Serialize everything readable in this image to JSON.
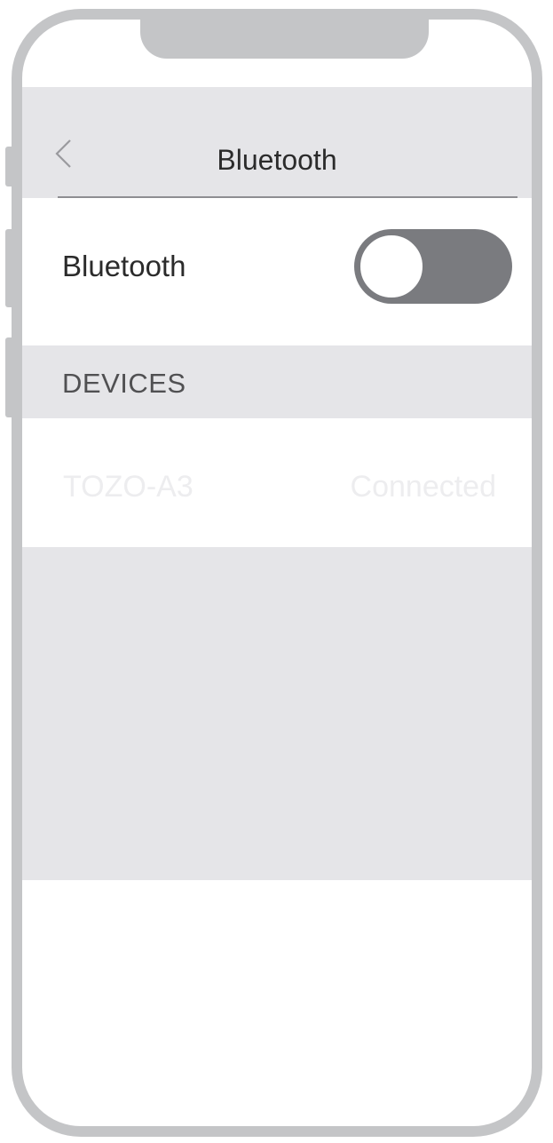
{
  "nav": {
    "title": "Bluetooth",
    "back_icon": "chevron-left-icon"
  },
  "bluetooth_toggle": {
    "label": "Bluetooth",
    "state": "off"
  },
  "devices_section": {
    "header": "DEVICES",
    "items": [
      {
        "name": "TOZO-A3",
        "status": "Connected"
      }
    ]
  },
  "colors": {
    "frame": "#c4c5c7",
    "nav_background": "#e5e5e8",
    "toggle_track": "#7a7b7f",
    "text_primary": "#2b2b2b",
    "text_faded": "#ededef"
  }
}
